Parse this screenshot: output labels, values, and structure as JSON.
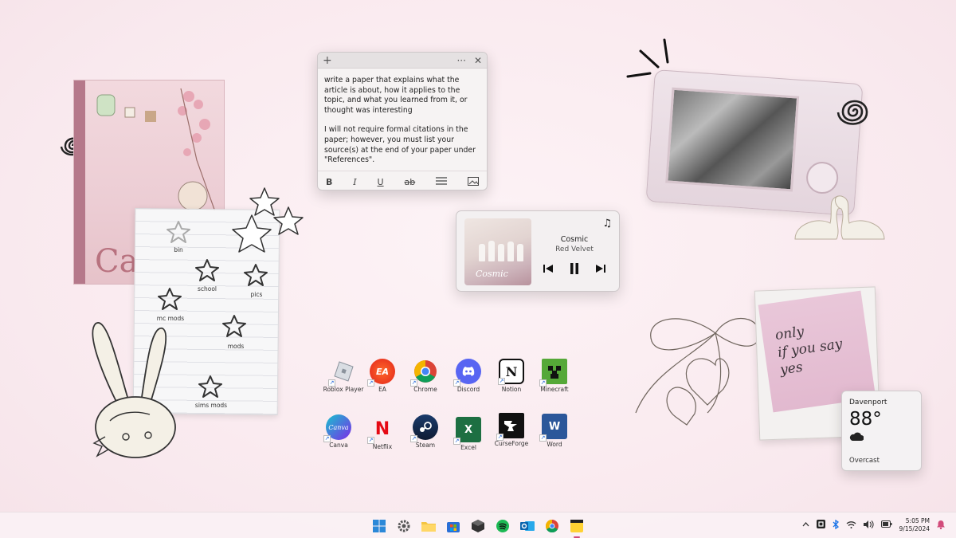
{
  "sticky_note": {
    "paragraph1": "write a paper that explains what the article is about, how it applies to the topic, and what you learned from it, or thought was interesting",
    "paragraph2": "I will not require formal citations in the paper; however, you must list your source(s) at the end of your paper under \"References\".",
    "add_icon": "+",
    "menu_icon": "···",
    "close_icon": "✕",
    "toolbar": {
      "bold": "B",
      "italic": "I",
      "underline": "U",
      "strike": "ab"
    }
  },
  "media": {
    "title": "Cosmic",
    "artist": "Red Velvet",
    "album_script": "Cosmic",
    "note_icon": "♫"
  },
  "weather": {
    "location": "Davenport",
    "temperature": "88°",
    "condition": "Overcast"
  },
  "folders": [
    {
      "label": "bin"
    },
    {
      "label": "school"
    },
    {
      "label": "pics"
    },
    {
      "label": "mc mods"
    },
    {
      "label": "mods"
    },
    {
      "label": "sims mods"
    }
  ],
  "desktop_icons_row1": [
    {
      "label": "Roblox Player",
      "icon": "roblox-icon"
    },
    {
      "label": "EA",
      "icon": "ea-icon"
    },
    {
      "label": "Chrome",
      "icon": "chrome-icon"
    },
    {
      "label": "Discord",
      "icon": "discord-icon"
    },
    {
      "label": "Notion",
      "icon": "notion-icon"
    },
    {
      "label": "Minecraft",
      "icon": "minecraft-icon"
    }
  ],
  "desktop_icons_row2": [
    {
      "label": "Canva",
      "icon": "canva-icon"
    },
    {
      "label": "Netflix",
      "icon": "netflix-icon"
    },
    {
      "label": "Steam",
      "icon": "steam-icon"
    },
    {
      "label": "Excel",
      "icon": "excel-icon"
    },
    {
      "label": "CurseForge",
      "icon": "curseforge-icon"
    },
    {
      "label": "Word",
      "icon": "word-icon"
    }
  ],
  "polaroid": {
    "text_line1": "only",
    "text_line2": "if you say",
    "text_line3": "yes"
  },
  "taskbar": {
    "time": "5:05 PM",
    "date": "9/15/2024"
  },
  "colors": {
    "accent": "#d24b7b",
    "background": "#f9e9ee"
  }
}
